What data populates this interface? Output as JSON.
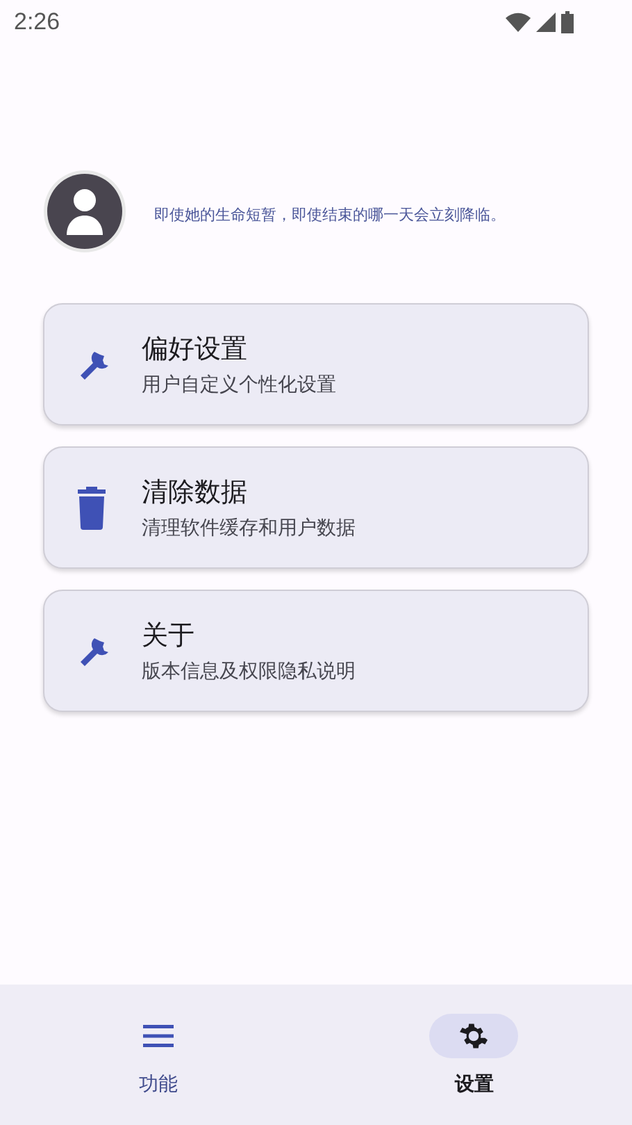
{
  "status_bar": {
    "time": "2:26"
  },
  "profile": {
    "motto": "即使她的生命短暂，即使结束的哪一天会立刻降临。"
  },
  "menu": [
    {
      "kind": "wrench",
      "title": "偏好设置",
      "subtitle": "用户自定义个性化设置"
    },
    {
      "kind": "trash",
      "title": "清除数据",
      "subtitle": "清理软件缓存和用户数据"
    },
    {
      "kind": "wrench",
      "title": "关于",
      "subtitle": "版本信息及权限隐私说明"
    }
  ],
  "bottom_nav": [
    {
      "kind": "menu",
      "label": "功能",
      "selected": false
    },
    {
      "kind": "gear",
      "label": "设置",
      "selected": true
    }
  ]
}
